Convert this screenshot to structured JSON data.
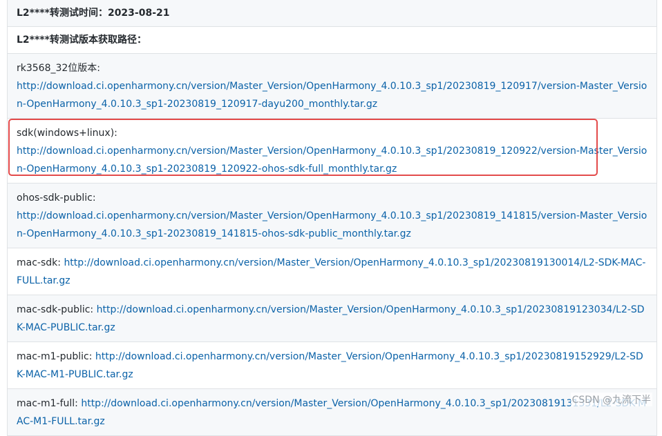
{
  "header": {
    "test_time": "L2****转测试时间：2023-08-21",
    "version_path": "L2****转测试版本获取路径："
  },
  "rows": [
    {
      "label": "rk3568_32位版本:",
      "url": "http://download.ci.openharmony.cn/version/Master_Version/OpenHarmony_4.0.10.3_sp1/20230819_120917/version-Master_Version-OpenHarmony_4.0.10.3_sp1-20230819_120917-dayu200_monthly.tar.gz"
    },
    {
      "label": "sdk(windows+linux):",
      "url": "http://download.ci.openharmony.cn/version/Master_Version/OpenHarmony_4.0.10.3_sp1/20230819_120922/version-Master_Version-OpenHarmony_4.0.10.3_sp1-20230819_120922-ohos-sdk-full_monthly.tar.gz"
    },
    {
      "label": "ohos-sdk-public:",
      "url": "http://download.ci.openharmony.cn/version/Master_Version/OpenHarmony_4.0.10.3_sp1/20230819_141815/version-Master_Version-OpenHarmony_4.0.10.3_sp1-20230819_141815-ohos-sdk-public_monthly.tar.gz"
    },
    {
      "label": "mac-sdk:",
      "url": "http://download.ci.openharmony.cn/version/Master_Version/OpenHarmony_4.0.10.3_sp1/20230819130014/L2-SDK-MAC-FULL.tar.gz"
    },
    {
      "label": "mac-sdk-public:",
      "url": "http://download.ci.openharmony.cn/version/Master_Version/OpenHarmony_4.0.10.3_sp1/20230819123034/L2-SDK-MAC-PUBLIC.tar.gz"
    },
    {
      "label": "mac-m1-public:",
      "url": "http://download.ci.openharmony.cn/version/Master_Version/OpenHarmony_4.0.10.3_sp1/20230819152929/L2-SDK-MAC-M1-PUBLIC.tar.gz"
    },
    {
      "label": "mac-m1-full:",
      "url": "http://download.ci.openharmony.cn/version/Master_Version/OpenHarmony_4.0.10.3_sp1/20230819131331/L2-SDK-MAC-M1-FULL.tar.gz"
    }
  ],
  "watermark": "CSDN @九流下半",
  "colors": {
    "link": "#0b62a8",
    "highlight": "#e34a4a",
    "border": "#dfe2e5",
    "alt_row": "#f6f8fa"
  }
}
